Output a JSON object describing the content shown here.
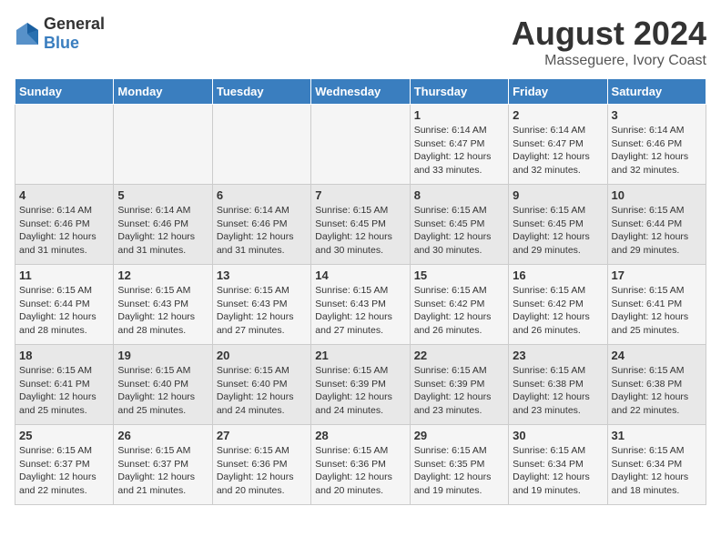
{
  "logo": {
    "general": "General",
    "blue": "Blue"
  },
  "title": "August 2024",
  "subtitle": "Masseguere, Ivory Coast",
  "days_of_week": [
    "Sunday",
    "Monday",
    "Tuesday",
    "Wednesday",
    "Thursday",
    "Friday",
    "Saturday"
  ],
  "weeks": [
    [
      {
        "num": "",
        "info": ""
      },
      {
        "num": "",
        "info": ""
      },
      {
        "num": "",
        "info": ""
      },
      {
        "num": "",
        "info": ""
      },
      {
        "num": "1",
        "info": "Sunrise: 6:14 AM\nSunset: 6:47 PM\nDaylight: 12 hours and 33 minutes."
      },
      {
        "num": "2",
        "info": "Sunrise: 6:14 AM\nSunset: 6:47 PM\nDaylight: 12 hours and 32 minutes."
      },
      {
        "num": "3",
        "info": "Sunrise: 6:14 AM\nSunset: 6:46 PM\nDaylight: 12 hours and 32 minutes."
      }
    ],
    [
      {
        "num": "4",
        "info": "Sunrise: 6:14 AM\nSunset: 6:46 PM\nDaylight: 12 hours and 31 minutes."
      },
      {
        "num": "5",
        "info": "Sunrise: 6:14 AM\nSunset: 6:46 PM\nDaylight: 12 hours and 31 minutes."
      },
      {
        "num": "6",
        "info": "Sunrise: 6:14 AM\nSunset: 6:46 PM\nDaylight: 12 hours and 31 minutes."
      },
      {
        "num": "7",
        "info": "Sunrise: 6:15 AM\nSunset: 6:45 PM\nDaylight: 12 hours and 30 minutes."
      },
      {
        "num": "8",
        "info": "Sunrise: 6:15 AM\nSunset: 6:45 PM\nDaylight: 12 hours and 30 minutes."
      },
      {
        "num": "9",
        "info": "Sunrise: 6:15 AM\nSunset: 6:45 PM\nDaylight: 12 hours and 29 minutes."
      },
      {
        "num": "10",
        "info": "Sunrise: 6:15 AM\nSunset: 6:44 PM\nDaylight: 12 hours and 29 minutes."
      }
    ],
    [
      {
        "num": "11",
        "info": "Sunrise: 6:15 AM\nSunset: 6:44 PM\nDaylight: 12 hours and 28 minutes."
      },
      {
        "num": "12",
        "info": "Sunrise: 6:15 AM\nSunset: 6:43 PM\nDaylight: 12 hours and 28 minutes."
      },
      {
        "num": "13",
        "info": "Sunrise: 6:15 AM\nSunset: 6:43 PM\nDaylight: 12 hours and 27 minutes."
      },
      {
        "num": "14",
        "info": "Sunrise: 6:15 AM\nSunset: 6:43 PM\nDaylight: 12 hours and 27 minutes."
      },
      {
        "num": "15",
        "info": "Sunrise: 6:15 AM\nSunset: 6:42 PM\nDaylight: 12 hours and 26 minutes."
      },
      {
        "num": "16",
        "info": "Sunrise: 6:15 AM\nSunset: 6:42 PM\nDaylight: 12 hours and 26 minutes."
      },
      {
        "num": "17",
        "info": "Sunrise: 6:15 AM\nSunset: 6:41 PM\nDaylight: 12 hours and 25 minutes."
      }
    ],
    [
      {
        "num": "18",
        "info": "Sunrise: 6:15 AM\nSunset: 6:41 PM\nDaylight: 12 hours and 25 minutes."
      },
      {
        "num": "19",
        "info": "Sunrise: 6:15 AM\nSunset: 6:40 PM\nDaylight: 12 hours and 25 minutes."
      },
      {
        "num": "20",
        "info": "Sunrise: 6:15 AM\nSunset: 6:40 PM\nDaylight: 12 hours and 24 minutes."
      },
      {
        "num": "21",
        "info": "Sunrise: 6:15 AM\nSunset: 6:39 PM\nDaylight: 12 hours and 24 minutes."
      },
      {
        "num": "22",
        "info": "Sunrise: 6:15 AM\nSunset: 6:39 PM\nDaylight: 12 hours and 23 minutes."
      },
      {
        "num": "23",
        "info": "Sunrise: 6:15 AM\nSunset: 6:38 PM\nDaylight: 12 hours and 23 minutes."
      },
      {
        "num": "24",
        "info": "Sunrise: 6:15 AM\nSunset: 6:38 PM\nDaylight: 12 hours and 22 minutes."
      }
    ],
    [
      {
        "num": "25",
        "info": "Sunrise: 6:15 AM\nSunset: 6:37 PM\nDaylight: 12 hours and 22 minutes."
      },
      {
        "num": "26",
        "info": "Sunrise: 6:15 AM\nSunset: 6:37 PM\nDaylight: 12 hours and 21 minutes."
      },
      {
        "num": "27",
        "info": "Sunrise: 6:15 AM\nSunset: 6:36 PM\nDaylight: 12 hours and 20 minutes."
      },
      {
        "num": "28",
        "info": "Sunrise: 6:15 AM\nSunset: 6:36 PM\nDaylight: 12 hours and 20 minutes."
      },
      {
        "num": "29",
        "info": "Sunrise: 6:15 AM\nSunset: 6:35 PM\nDaylight: 12 hours and 19 minutes."
      },
      {
        "num": "30",
        "info": "Sunrise: 6:15 AM\nSunset: 6:34 PM\nDaylight: 12 hours and 19 minutes."
      },
      {
        "num": "31",
        "info": "Sunrise: 6:15 AM\nSunset: 6:34 PM\nDaylight: 12 hours and 18 minutes."
      }
    ]
  ]
}
